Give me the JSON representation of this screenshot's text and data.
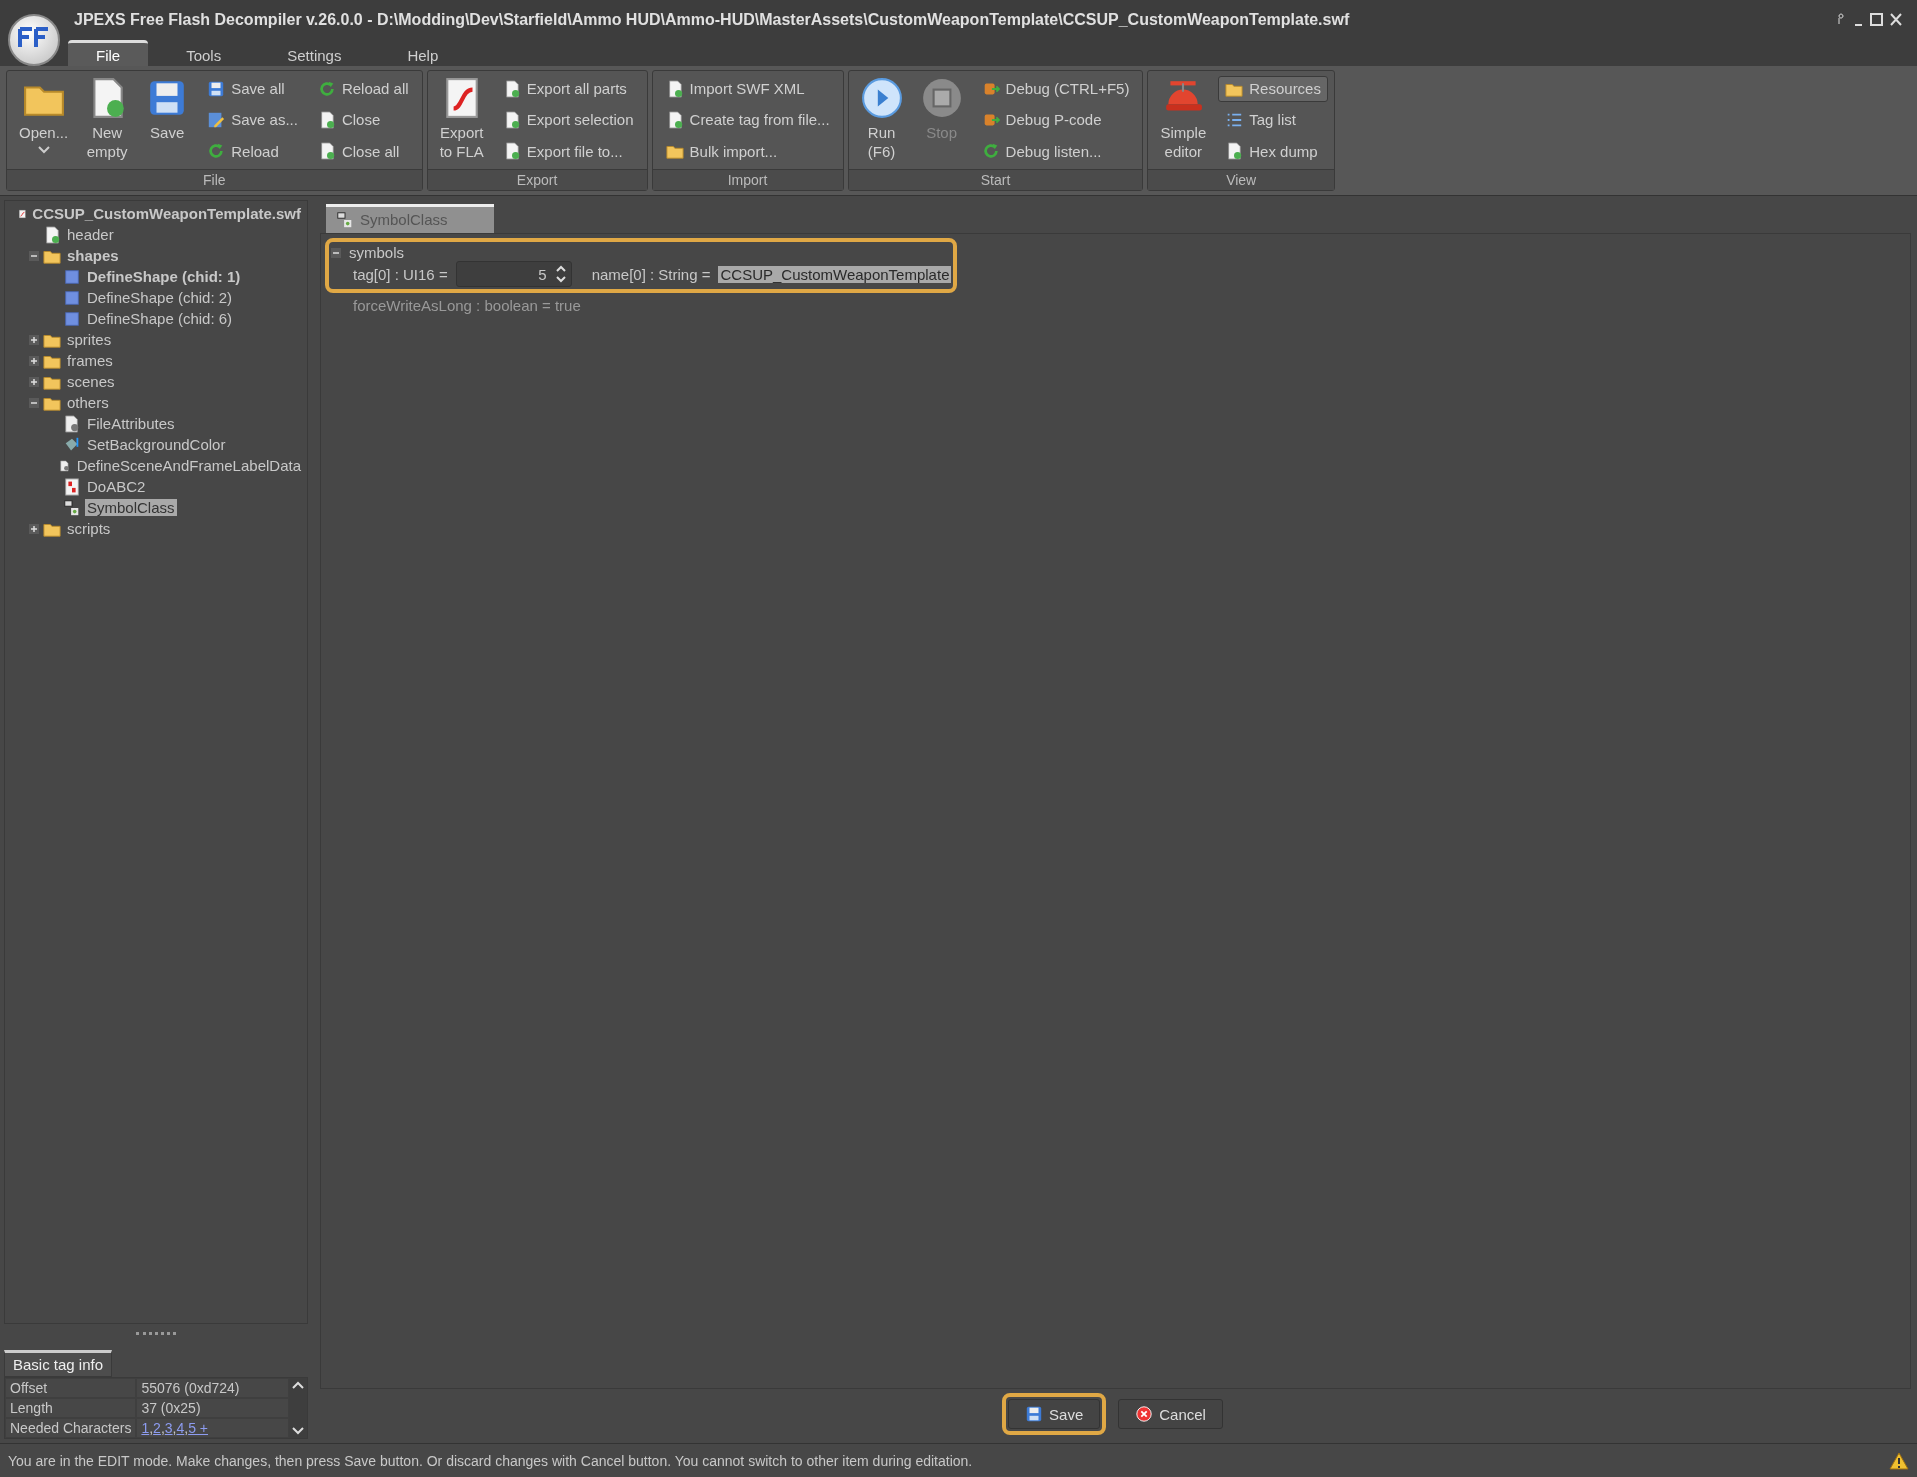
{
  "window": {
    "title": "JPEXS Free Flash Decompiler v.26.0.0 - D:\\Modding\\Dev\\Starfield\\Ammo HUD\\Ammo-HUD\\MasterAssets\\CustomWeaponTemplate\\CCSUP_CustomWeaponTemplate.swf"
  },
  "menu_tabs": [
    {
      "label": "File",
      "selected": true
    },
    {
      "label": "Tools",
      "selected": false
    },
    {
      "label": "Settings",
      "selected": false
    },
    {
      "label": "Help",
      "selected": false
    }
  ],
  "ribbon": [
    {
      "label": "File",
      "items": [
        {
          "kind": "large",
          "label": "Open...",
          "dropdown": true,
          "disabled": false
        },
        {
          "kind": "large",
          "label": "New\nempty",
          "dropdown": false,
          "disabled": false
        },
        {
          "kind": "large",
          "label": "Save",
          "dropdown": false,
          "disabled": false
        },
        {
          "kind": "stack",
          "buttons": [
            {
              "label": "Save all",
              "selected": false
            },
            {
              "label": "Save as...",
              "selected": false
            },
            {
              "label": "Reload",
              "selected": false
            }
          ]
        },
        {
          "kind": "stack",
          "buttons": [
            {
              "label": "Reload all",
              "selected": false
            },
            {
              "label": "Close",
              "selected": false
            },
            {
              "label": "Close all",
              "selected": false
            }
          ]
        }
      ]
    },
    {
      "label": "Export",
      "items": [
        {
          "kind": "large",
          "label": "Export\nto FLA",
          "dropdown": false,
          "disabled": false
        },
        {
          "kind": "stack",
          "buttons": [
            {
              "label": "Export all parts",
              "selected": false
            },
            {
              "label": "Export selection",
              "selected": false
            },
            {
              "label": "Export file to...",
              "selected": false
            }
          ]
        }
      ]
    },
    {
      "label": "Import",
      "items": [
        {
          "kind": "stack",
          "buttons": [
            {
              "label": "Import SWF XML",
              "selected": false
            },
            {
              "label": "Create tag from file...",
              "selected": false
            },
            {
              "label": "Bulk import...",
              "selected": false
            }
          ]
        }
      ]
    },
    {
      "label": "Start",
      "items": [
        {
          "kind": "large",
          "label": "Run\n(F6)",
          "dropdown": false,
          "disabled": false
        },
        {
          "kind": "large",
          "label": "Stop",
          "dropdown": false,
          "disabled": true
        },
        {
          "kind": "stack",
          "buttons": [
            {
              "label": "Debug (CTRL+F5)",
              "selected": false
            },
            {
              "label": "Debug P-code",
              "selected": false
            },
            {
              "label": "Debug listen...",
              "selected": false
            }
          ]
        }
      ]
    },
    {
      "label": "View",
      "items": [
        {
          "kind": "large",
          "label": "Simple\neditor",
          "dropdown": false,
          "disabled": false
        },
        {
          "kind": "stack",
          "buttons": [
            {
              "label": "Resources",
              "selected": true
            },
            {
              "label": "Tag list",
              "selected": false
            },
            {
              "label": "Hex dump",
              "selected": false
            }
          ]
        }
      ]
    }
  ],
  "tree": {
    "label": "CCSUP_CustomWeaponTemplate.swf",
    "kind": "swf",
    "children": [
      {
        "label": "header",
        "kind": "header",
        "bold": false,
        "selected": false
      },
      {
        "label": "shapes",
        "kind": "folder",
        "bold": true,
        "selected": false,
        "expanded": true,
        "children": [
          {
            "label": "DefineShape (chid: 1)",
            "kind": "shape",
            "bold": true,
            "selected": false
          },
          {
            "label": "DefineShape (chid: 2)",
            "kind": "shape",
            "bold": false,
            "selected": false
          },
          {
            "label": "DefineShape (chid: 6)",
            "kind": "shape",
            "bold": false,
            "selected": false
          }
        ]
      },
      {
        "label": "sprites",
        "kind": "folder",
        "bold": false,
        "selected": false,
        "expanded": false
      },
      {
        "label": "frames",
        "kind": "folder",
        "bold": false,
        "selected": false,
        "expanded": false
      },
      {
        "label": "scenes",
        "kind": "folder",
        "bold": false,
        "selected": false,
        "expanded": false
      },
      {
        "label": "others",
        "kind": "folder",
        "bold": false,
        "selected": false,
        "expanded": true,
        "children": [
          {
            "label": "FileAttributes",
            "kind": "attributes",
            "bold": false,
            "selected": false
          },
          {
            "label": "SetBackgroundColor",
            "kind": "color",
            "bold": false,
            "selected": false
          },
          {
            "label": "DefineSceneAndFrameLabelData",
            "kind": "attributes",
            "bold": false,
            "selected": false
          },
          {
            "label": "DoABC2",
            "kind": "code",
            "bold": false,
            "selected": false
          },
          {
            "label": "SymbolClass",
            "kind": "symbol",
            "bold": false,
            "selected": true
          }
        ]
      },
      {
        "label": "scripts",
        "kind": "folder",
        "bold": false,
        "selected": false,
        "expanded": false
      }
    ]
  },
  "tag_info": {
    "tab": "Basic tag info",
    "rows": [
      {
        "name": "Offset",
        "value": "55076 (0xd724)"
      },
      {
        "name": "Length",
        "value": "37 (0x25)"
      },
      {
        "name": "Needed Characters",
        "links": [
          "1",
          "2",
          "3",
          "4",
          "5 +"
        ],
        "separator": ", "
      }
    ]
  },
  "editor": {
    "tab": "SymbolClass",
    "highlighted": true,
    "root": {
      "label": "symbols",
      "expanded": true
    },
    "tag_label": "tag[0] : UI16 =",
    "tag_value": "5",
    "name_label": "name[0] : String =",
    "name_value": "CCSUP_CustomWeaponTemplate",
    "extra": "forceWriteAsLong : boolean = true"
  },
  "actions": [
    {
      "label": "Save",
      "highlighted": true
    },
    {
      "label": "Cancel",
      "highlighted": false
    }
  ],
  "status_bar": "You are in the EDIT mode. Make changes, then press Save button. Or discard changes with Cancel button. You cannot switch to other item during editation."
}
